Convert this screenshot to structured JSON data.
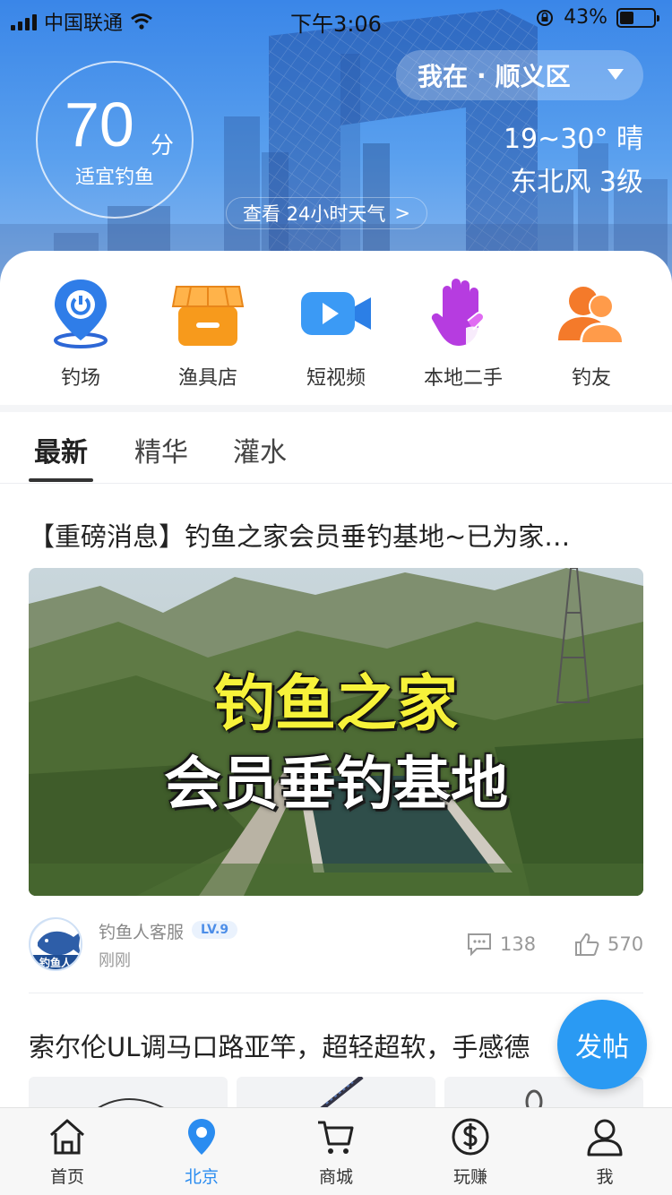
{
  "status_bar": {
    "carrier": "中国联通",
    "time": "下午3:06",
    "battery": "43%",
    "battery_level": 0.43
  },
  "header": {
    "score": "70",
    "score_unit": "分",
    "score_text": "适宜钓鱼",
    "location_prefix": "我在",
    "location_separator": "·",
    "location_name": "顺义区",
    "temperature": "19~30° 晴",
    "wind": "东北风 3级",
    "weather_link": "查看 24小时天气",
    "weather_link_arrow": ">"
  },
  "quick_entries": [
    {
      "label": "钓场",
      "icon": "location-pin-icon"
    },
    {
      "label": "渔具店",
      "icon": "shop-icon"
    },
    {
      "label": "短视频",
      "icon": "video-camera-icon"
    },
    {
      "label": "本地二手",
      "icon": "hand-icon"
    },
    {
      "label": "钓友",
      "icon": "friends-icon"
    }
  ],
  "tabs": [
    {
      "label": "最新",
      "active": true
    },
    {
      "label": "精华",
      "active": false
    },
    {
      "label": "灌水",
      "active": false
    }
  ],
  "posts": [
    {
      "title": "【重磅消息】钓鱼之家会员垂钓基地~已为家…",
      "cover_line1": "钓鱼之家",
      "cover_line2": "会员垂钓基地",
      "author": "钓鱼人客服",
      "level": "LV.9",
      "time": "刚刚",
      "comments": "138",
      "likes": "570",
      "avatar_text": "钓鱼人"
    },
    {
      "title": "索尔伦UL调马口路亚竿，超轻超软，手感德"
    }
  ],
  "fab_label": "发帖",
  "tabbar": [
    {
      "label": "首页",
      "icon": "home-icon",
      "active": false
    },
    {
      "label": "北京",
      "icon": "location-icon",
      "active": true
    },
    {
      "label": "商城",
      "icon": "cart-icon",
      "active": false
    },
    {
      "label": "玩赚",
      "icon": "dollar-coin-icon",
      "active": false
    },
    {
      "label": "我",
      "icon": "user-icon",
      "active": false
    }
  ],
  "colors": {
    "accent": "#2a8cf0",
    "fab": "#2a9af3",
    "hero_top": "#3a86e8"
  }
}
